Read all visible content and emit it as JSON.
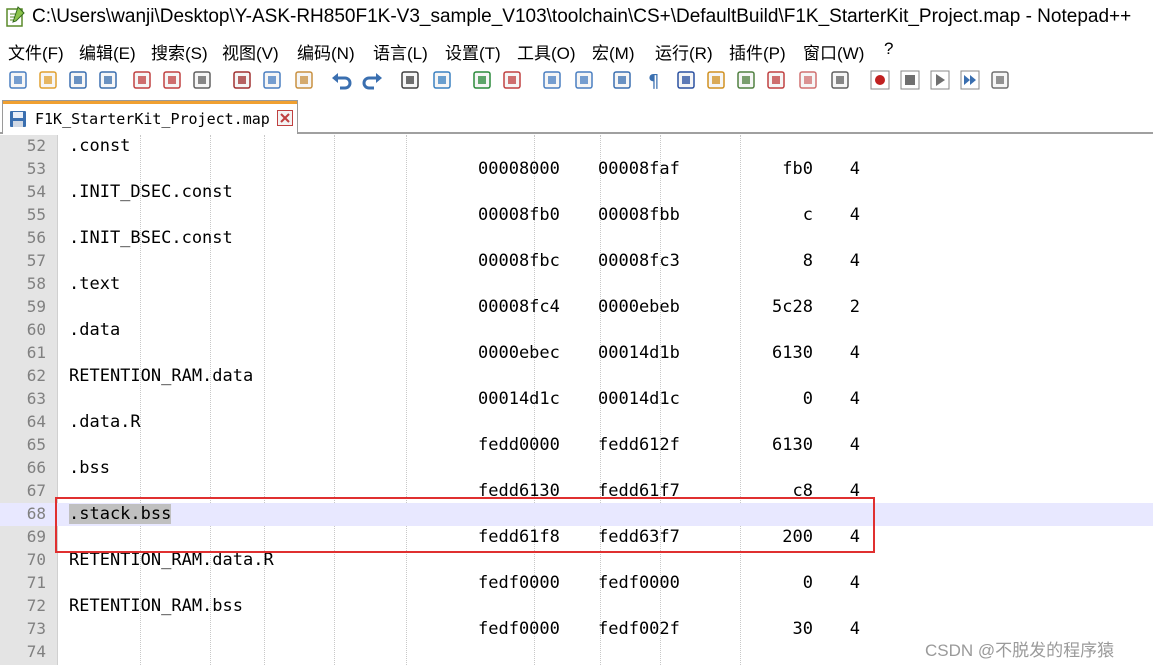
{
  "window": {
    "title": "C:\\Users\\wanji\\Desktop\\Y-ASK-RH850F1K-V3_sample_V103\\toolchain\\CS+\\DefaultBuild\\F1K_StarterKit_Project.map - Notepad++",
    "app_icon": "notepad-plus-plus-icon"
  },
  "menu": [
    {
      "label": "文件(F)"
    },
    {
      "label": "编辑(E)"
    },
    {
      "label": "搜索(S)"
    },
    {
      "label": "视图(V)"
    },
    {
      "label": "编码(N)"
    },
    {
      "label": "语言(L)"
    },
    {
      "label": "设置(T)"
    },
    {
      "label": "工具(O)"
    },
    {
      "label": "宏(M)"
    },
    {
      "label": "运行(R)"
    },
    {
      "label": "插件(P)"
    },
    {
      "label": "窗口(W)"
    },
    {
      "label": "?"
    }
  ],
  "toolbar": [
    "new-file-icon",
    "open-file-icon",
    "save-icon",
    "save-all-icon",
    "close-icon",
    "close-all-icon",
    "print-icon",
    "cut-icon",
    "copy-icon",
    "paste-icon",
    "undo-icon",
    "redo-icon",
    "find-icon",
    "replace-icon",
    "zoom-in-icon",
    "zoom-out-icon",
    "sync-vertical-icon",
    "sync-horizontal-icon",
    "word-wrap-icon",
    "show-all-chars-icon",
    "indent-guide-icon",
    "language-udl-icon",
    "doc-map-icon",
    "function-list-icon",
    "folder-workspace-icon",
    "monitoring-icon",
    "record-macro-icon",
    "stop-record-icon",
    "playback-macro-icon",
    "run-macro-multiple-icon",
    "save-macro-icon"
  ],
  "tab": {
    "label": "F1K_StarterKit_Project.map",
    "modified": false
  },
  "lines": [
    {
      "n": "52",
      "section": ".const"
    },
    {
      "n": "53",
      "start": "00008000",
      "end": "00008faf",
      "size": "fb0",
      "align": "4"
    },
    {
      "n": "54",
      "section": ".INIT_DSEC.const"
    },
    {
      "n": "55",
      "start": "00008fb0",
      "end": "00008fbb",
      "size": "c",
      "align": "4"
    },
    {
      "n": "56",
      "section": ".INIT_BSEC.const"
    },
    {
      "n": "57",
      "start": "00008fbc",
      "end": "00008fc3",
      "size": "8",
      "align": "4"
    },
    {
      "n": "58",
      "section": ".text"
    },
    {
      "n": "59",
      "start": "00008fc4",
      "end": "0000ebeb",
      "size": "5c28",
      "align": "2"
    },
    {
      "n": "60",
      "section": ".data"
    },
    {
      "n": "61",
      "start": "0000ebec",
      "end": "00014d1b",
      "size": "6130",
      "align": "4"
    },
    {
      "n": "62",
      "section": "RETENTION_RAM.data"
    },
    {
      "n": "63",
      "start": "00014d1c",
      "end": "00014d1c",
      "size": "0",
      "align": "4"
    },
    {
      "n": "64",
      "section": ".data.R"
    },
    {
      "n": "65",
      "start": "fedd0000",
      "end": "fedd612f",
      "size": "6130",
      "align": "4"
    },
    {
      "n": "66",
      "section": ".bss"
    },
    {
      "n": "67",
      "start": "fedd6130",
      "end": "fedd61f7",
      "size": "c8",
      "align": "4"
    },
    {
      "n": "68",
      "section": ".stack.bss",
      "current": true,
      "selected": true
    },
    {
      "n": "69",
      "start": "fedd61f8",
      "end": "fedd63f7",
      "size": "200",
      "align": "4"
    },
    {
      "n": "70",
      "section": "RETENTION_RAM.data.R"
    },
    {
      "n": "71",
      "start": "fedf0000",
      "end": "fedf0000",
      "size": "0",
      "align": "4"
    },
    {
      "n": "72",
      "section": "RETENTION_RAM.bss"
    },
    {
      "n": "73",
      "start": "fedf0000",
      "end": "fedf002f",
      "size": "30",
      "align": "4"
    },
    {
      "n": "74"
    }
  ],
  "colors": {
    "current_line": "#e8e8ff",
    "selection": "#c0c0c0",
    "highlight_box": "#e03030",
    "line_numbers": "#808080",
    "tab_accent": "#f0a030"
  },
  "watermark": "CSDN @不脱发的程序猿"
}
